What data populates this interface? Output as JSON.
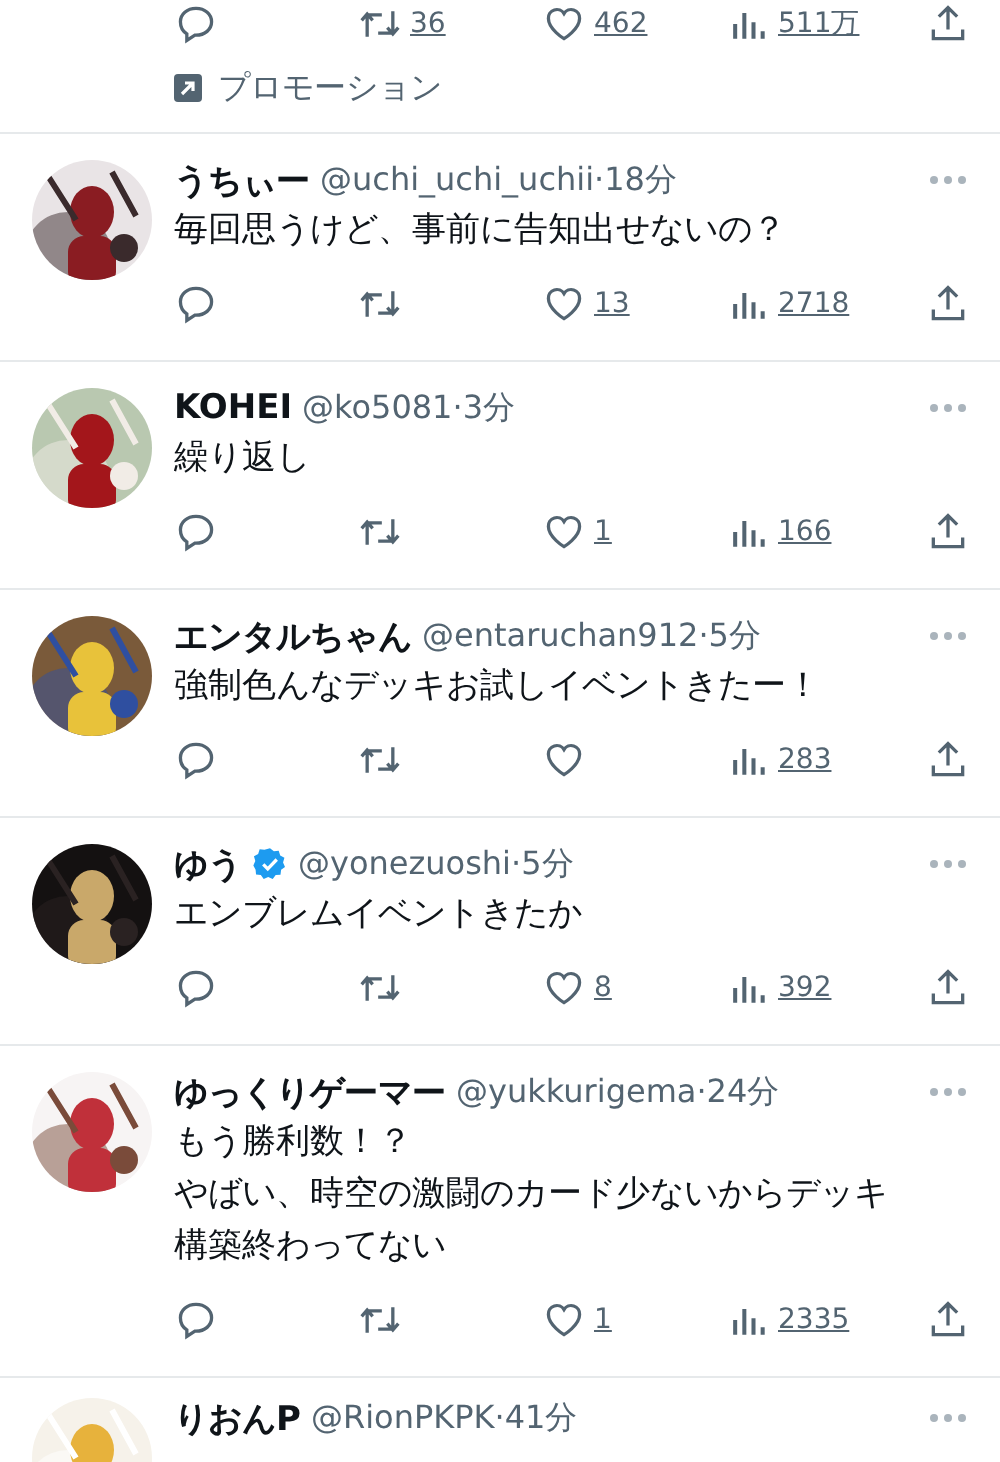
{
  "promoted_tail": {
    "actions": [
      {
        "kind": "reply"
      },
      {
        "kind": "retweet",
        "count": "36"
      },
      {
        "kind": "like",
        "count": "462"
      },
      {
        "kind": "views",
        "count": "511万"
      },
      {
        "kind": "share"
      }
    ],
    "label": "プロモーション"
  },
  "tweets": [
    {
      "name": "うちぃー",
      "verified": false,
      "meta": "@uchi_uchi_uchii·18分",
      "text": [
        "毎回思うけど、事前に告知出せないの？"
      ],
      "actions": [
        {
          "kind": "reply"
        },
        {
          "kind": "retweet"
        },
        {
          "kind": "like",
          "count": "13"
        },
        {
          "kind": "views",
          "count": "2718"
        },
        {
          "kind": "share"
        }
      ]
    },
    {
      "name": "KOHEI",
      "verified": false,
      "meta": "@ko5081·3分",
      "text": [
        "繰り返し"
      ],
      "actions": [
        {
          "kind": "reply"
        },
        {
          "kind": "retweet"
        },
        {
          "kind": "like",
          "count": "1"
        },
        {
          "kind": "views",
          "count": "166"
        },
        {
          "kind": "share"
        }
      ]
    },
    {
      "name": "エンタルちゃん",
      "verified": false,
      "meta": "@entaruchan912·5分",
      "text": [
        "強制色んなデッキお試しイベントきたー！"
      ],
      "actions": [
        {
          "kind": "reply"
        },
        {
          "kind": "retweet"
        },
        {
          "kind": "like"
        },
        {
          "kind": "views",
          "count": "283"
        },
        {
          "kind": "share"
        }
      ]
    },
    {
      "name": "ゆう",
      "verified": true,
      "meta": "@yonezuoshi·5分",
      "text": [
        "エンブレムイベントきたか"
      ],
      "actions": [
        {
          "kind": "reply"
        },
        {
          "kind": "retweet"
        },
        {
          "kind": "like",
          "count": "8"
        },
        {
          "kind": "views",
          "count": "392"
        },
        {
          "kind": "share"
        }
      ]
    },
    {
      "name": "ゆっくりゲーマー",
      "verified": false,
      "meta": "@yukkurigema·24分",
      "text": [
        "もう勝利数！？",
        "やばい、時空の激闘のカード少ないからデッキ構築終わってない"
      ],
      "actions": [
        {
          "kind": "reply"
        },
        {
          "kind": "retweet"
        },
        {
          "kind": "like",
          "count": "1"
        },
        {
          "kind": "views",
          "count": "2335"
        },
        {
          "kind": "share"
        }
      ]
    },
    {
      "name": "りおんP",
      "verified": false,
      "meta": "@RionPKPK·41分"
    }
  ]
}
